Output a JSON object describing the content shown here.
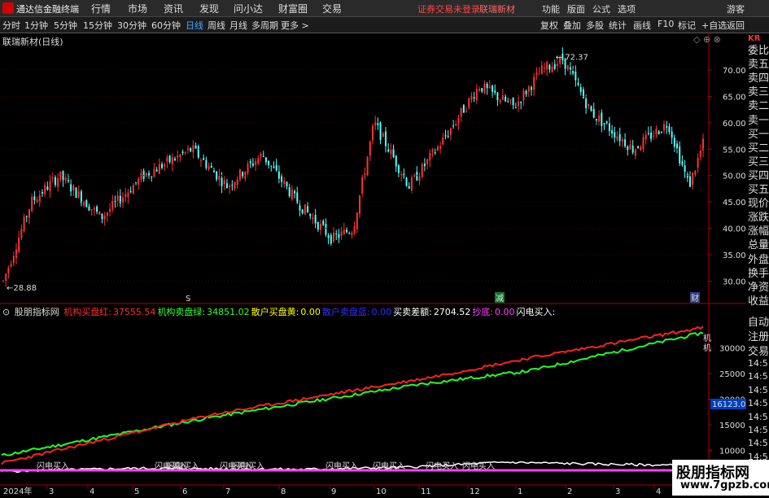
{
  "app": {
    "title": "通达信金融终端",
    "menus": [
      "行情",
      "市场",
      "资讯",
      "发现",
      "问小达",
      "财富圈",
      "交易"
    ],
    "status_text": "证券交易未登录",
    "stock_name": "联瑞新材",
    "right_menus": [
      "功能",
      "版面",
      "公式",
      "选项"
    ],
    "guest": "游客"
  },
  "toolbar": {
    "periods": [
      "分时",
      "1分钟",
      "5分钟",
      "15分钟",
      "30分钟",
      "60分钟",
      "日线",
      "周线",
      "月线",
      "多周期",
      "更多 >"
    ],
    "active_period": "日线",
    "right_buttons": [
      "复权",
      "叠加",
      "多股",
      "统计",
      "画线",
      "F10",
      "+自选",
      "返回"
    ]
  },
  "chart": {
    "title": "联瑞新材(日线)",
    "price_axis": [
      "70.00",
      "65.00",
      "60.00",
      "55.00",
      "50.00",
      "45.00",
      "40.00",
      "35.00",
      "30.00"
    ],
    "high_label": "72.37",
    "low_label": "28.88",
    "markers": [
      "S",
      "减",
      "财"
    ]
  },
  "indicator": {
    "name": "股朋指标网",
    "items": [
      {
        "label": "机构买盘红:",
        "value": "37555.54",
        "color": "#ff3030"
      },
      {
        "label": "机构卖盘绿:",
        "value": "34851.02",
        "color": "#30ff30"
      },
      {
        "label": "散户买盘黄:",
        "value": "0.00",
        "color": "#ffff00"
      },
      {
        "label": "散户卖盘蓝:",
        "value": "0.00",
        "color": "#3030ff"
      },
      {
        "label": "买卖差额:",
        "value": "2704.52",
        "color": "#ffffff"
      },
      {
        "label": "抄底:",
        "value": "0.00",
        "color": "#ff40ff"
      },
      {
        "label": "闪电买入:",
        "value": "",
        "color": "#ffffff"
      }
    ],
    "axis": [
      "30000",
      "25000",
      "20000",
      "15000",
      "10000"
    ],
    "current_value": "16123.06",
    "line_tags": [
      "机",
      "机"
    ],
    "signal_label": "闪电买入"
  },
  "sidebar": {
    "header": "KR",
    "quote_items": [
      "委比",
      "卖五",
      "卖四",
      "卖三",
      "卖二",
      "卖一",
      "买一",
      "买二",
      "买三",
      "买四",
      "买五",
      "现价",
      "涨跌",
      "涨幅",
      "总量",
      "外盘",
      "换手",
      "净资",
      "收益"
    ],
    "bottom_items": [
      "自动",
      "注册",
      "交易"
    ],
    "time_ticks": [
      "14:5",
      "14:5",
      "14:5",
      "14:5",
      "14:5",
      "14:5",
      "14:5",
      "14:5",
      "14:5",
      "14:5"
    ]
  },
  "date_axis": {
    "year": "2024年",
    "months": [
      "3",
      "4",
      "5",
      "6",
      "7",
      "8",
      "9",
      "10",
      "11",
      "12",
      "1",
      "2",
      "3",
      "4"
    ]
  },
  "watermark": {
    "line1": "股朋指标网",
    "line2": "www.7gpzb.com"
  },
  "colors": {
    "up": "#ff3232",
    "down": "#54ffff",
    "ma_red": "#ff2020",
    "ma_green": "#20ff20",
    "signal": "#ff40ff"
  },
  "chart_data": {
    "type": "candlestick",
    "price_range": [
      27,
      74
    ],
    "high": 72.37,
    "low": 28.88,
    "price_trend": [
      [
        0,
        30
      ],
      [
        0.04,
        45
      ],
      [
        0.08,
        50
      ],
      [
        0.14,
        42
      ],
      [
        0.2,
        50
      ],
      [
        0.27,
        55
      ],
      [
        0.32,
        48
      ],
      [
        0.37,
        54
      ],
      [
        0.42,
        45
      ],
      [
        0.47,
        38
      ],
      [
        0.5,
        40
      ],
      [
        0.53,
        60
      ],
      [
        0.58,
        48
      ],
      [
        0.63,
        57
      ],
      [
        0.68,
        67
      ],
      [
        0.73,
        63
      ],
      [
        0.77,
        70
      ],
      [
        0.8,
        72
      ],
      [
        0.84,
        62
      ],
      [
        0.9,
        55
      ],
      [
        0.95,
        60
      ],
      [
        0.98,
        48
      ],
      [
        1.0,
        56
      ]
    ],
    "red_line": [
      [
        0,
        7500
      ],
      [
        0.3,
        17000
      ],
      [
        0.6,
        24000
      ],
      [
        0.75,
        28000
      ],
      [
        1.0,
        34000
      ]
    ],
    "green_line": [
      [
        0,
        9000
      ],
      [
        0.3,
        16500
      ],
      [
        0.6,
        23000
      ],
      [
        0.75,
        25500
      ],
      [
        1.0,
        33000
      ]
    ],
    "white_spikes": [
      [
        0.0,
        -500
      ],
      [
        0.2,
        1000
      ],
      [
        0.45,
        500
      ],
      [
        0.6,
        1500
      ],
      [
        0.75,
        4000
      ],
      [
        0.9,
        3000
      ],
      [
        1.0,
        2500
      ]
    ]
  }
}
